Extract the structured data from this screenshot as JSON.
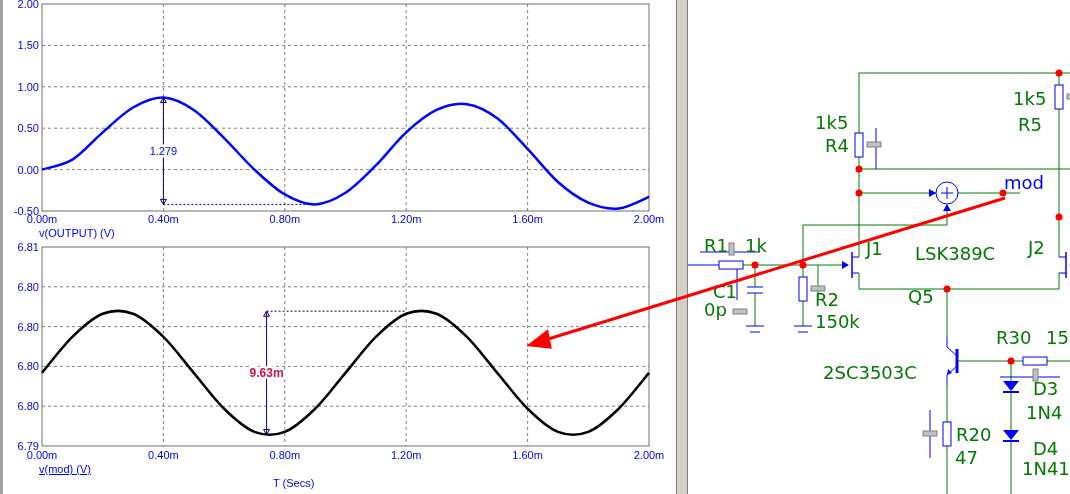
{
  "plots": [
    {
      "legend_underlined": false,
      "chart_data": {
        "type": "line",
        "grid": true,
        "x": [
          0,
          0.1,
          0.2,
          0.3,
          0.4,
          0.5,
          0.6,
          0.7,
          0.8,
          0.9,
          1.0,
          1.1,
          1.2,
          1.3,
          1.4,
          1.5,
          1.6,
          1.7,
          1.8,
          1.9,
          2.0
        ],
        "series": [
          {
            "name": "v(OUTPUT) (V)",
            "color": "#0000ff",
            "values": [
              0.0,
              0.12,
              0.45,
              0.75,
              0.87,
              0.72,
              0.38,
              0.0,
              -0.3,
              -0.42,
              -0.28,
              0.05,
              0.45,
              0.72,
              0.79,
              0.62,
              0.25,
              -0.15,
              -0.4,
              -0.47,
              -0.33
            ]
          }
        ],
        "xlim": [
          0,
          2
        ],
        "ylim": [
          -0.5,
          2.0
        ],
        "xticks": [
          {
            "value": 0,
            "label": "0.00m"
          },
          {
            "value": 0.4,
            "label": "0.40m"
          },
          {
            "value": 0.8,
            "label": "0.80m"
          },
          {
            "value": 1.2,
            "label": "1.20m"
          },
          {
            "value": 1.6,
            "label": "1.60m"
          },
          {
            "value": 2.0,
            "label": "2.00m"
          }
        ],
        "yticks": [
          {
            "value": -0.5,
            "label": "-0.50"
          },
          {
            "value": 0,
            "label": "0.00"
          },
          {
            "value": 0.5,
            "label": "0.50"
          },
          {
            "value": 1.0,
            "label": "1.00"
          },
          {
            "value": 1.5,
            "label": "1.50"
          },
          {
            "value": 2.0,
            "label": "2.00"
          }
        ],
        "ref_lines": [
          {
            "axis": "x",
            "value": 0.4
          }
        ],
        "annotations": [
          "1.279"
        ]
      }
    },
    {
      "legend_underlined": true,
      "chart_data": {
        "type": "line",
        "grid": true,
        "xlabel": "T (Secs)",
        "x": [
          0,
          0.1,
          0.2,
          0.3,
          0.4,
          0.5,
          0.6,
          0.7,
          0.8,
          0.9,
          1.0,
          1.1,
          1.2,
          1.3,
          1.4,
          1.5,
          1.6,
          1.7,
          1.8,
          1.9,
          2.0
        ],
        "series": [
          {
            "name": "v(mod) (V)",
            "color": "#000000",
            "values": [
              6.7977,
              6.8005,
              6.8023,
              6.8023,
              6.8005,
              6.7977,
              6.7949,
              6.7931,
              6.7931,
              6.7949,
              6.7977,
              6.8005,
              6.8023,
              6.8023,
              6.8005,
              6.7977,
              6.7949,
              6.7931,
              6.7931,
              6.7949,
              6.7977
            ]
          }
        ],
        "xlim": [
          0,
          2
        ],
        "ylim": [
          6.792,
          6.8075
        ],
        "xticks": [
          {
            "value": 0,
            "label": "0.00m"
          },
          {
            "value": 0.4,
            "label": "0.40m"
          },
          {
            "value": 0.8,
            "label": "0.80m"
          },
          {
            "value": 1.2,
            "label": "1.20m"
          },
          {
            "value": 1.6,
            "label": "1.60m"
          },
          {
            "value": 2.0,
            "label": "2.00m"
          }
        ],
        "yticks": [
          {
            "value": 6.792,
            "label": "6.79"
          },
          {
            "value": 6.7951,
            "label": "6.80"
          },
          {
            "value": 6.7982,
            "label": "6.80"
          },
          {
            "value": 6.8013,
            "label": "6.80"
          },
          {
            "value": 6.8044,
            "label": "6.80"
          },
          {
            "value": 6.8075,
            "label": "6.81"
          }
        ],
        "ref_lines": [
          {
            "axis": "x",
            "value": 0.74
          }
        ],
        "annotations": [
          "9.63m"
        ]
      }
    }
  ],
  "schematic": {
    "net_label": "mod",
    "parts": [
      {
        "kind": "resistor",
        "ref": "R4",
        "value": "1k5"
      },
      {
        "kind": "resistor",
        "ref": "R5",
        "value": "1k5"
      },
      {
        "kind": "resistor",
        "ref": "R1",
        "value": "1k"
      },
      {
        "kind": "capacitor",
        "ref": "C1",
        "value": "0p"
      },
      {
        "kind": "resistor",
        "ref": "R2",
        "value": "150k"
      },
      {
        "kind": "jfet",
        "ref": "J1",
        "value": "LSK389C"
      },
      {
        "kind": "jfet",
        "ref": "J2"
      },
      {
        "kind": "npn",
        "ref": "Q5",
        "value": "2SC3503C"
      },
      {
        "kind": "resistor",
        "ref": "R30",
        "value": "15"
      },
      {
        "kind": "diode",
        "ref": "D3",
        "value": "1N4"
      },
      {
        "kind": "diode",
        "ref": "D4",
        "value": "1N41"
      },
      {
        "kind": "resistor",
        "ref": "R20",
        "value": "47"
      }
    ]
  }
}
